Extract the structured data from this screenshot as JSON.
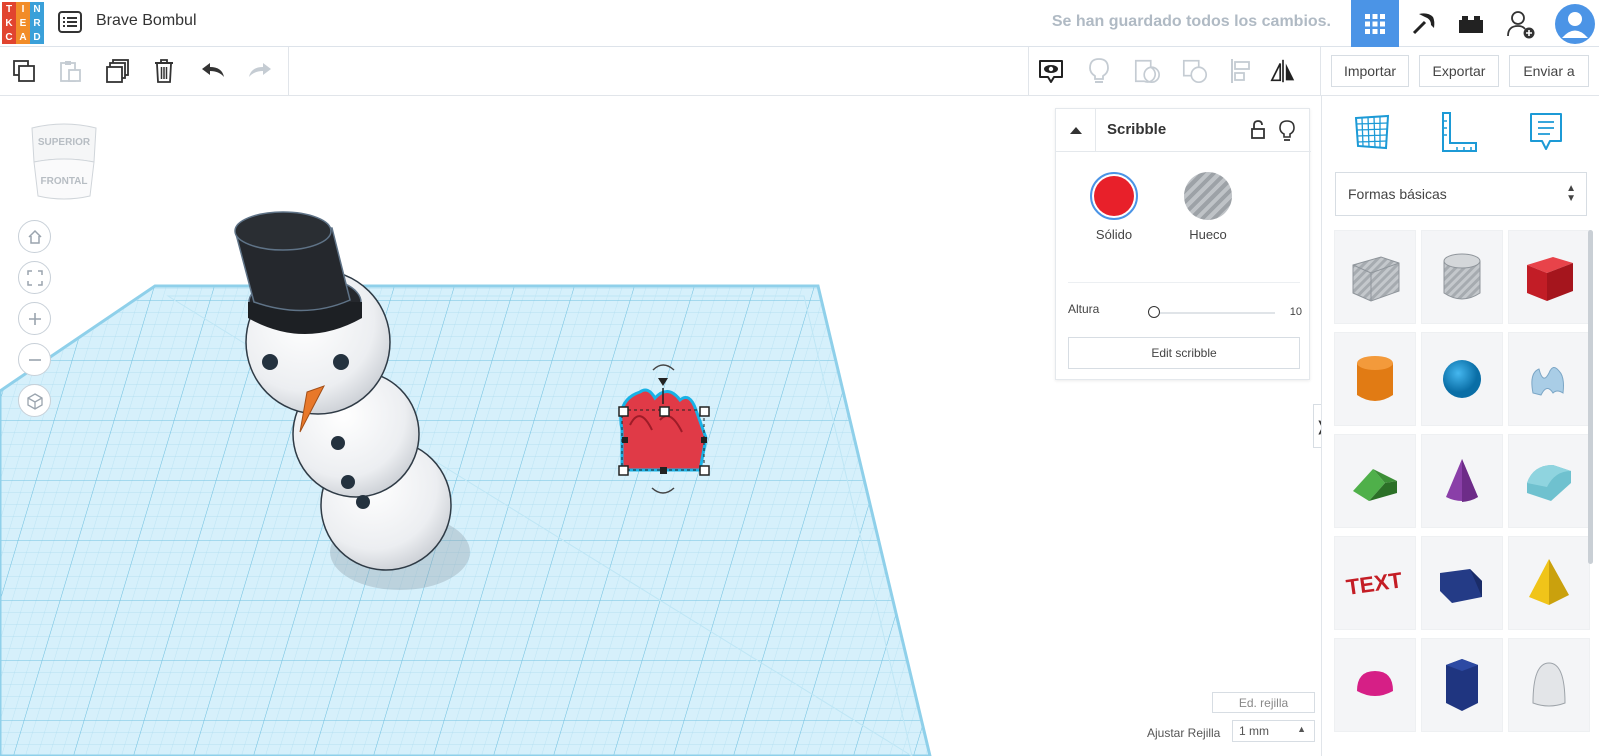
{
  "app": {
    "logo_letters": [
      "T",
      "I",
      "N",
      "K",
      "E",
      "R",
      "C",
      "A",
      "D"
    ],
    "logo_colors": [
      "#e1442f",
      "#f28c28",
      "#3aa0d9",
      "#e1442f",
      "#f28c28",
      "#3aa0d9",
      "#e1442f",
      "#f28c28",
      "#3aa0d9"
    ],
    "design_title": "Brave Bombul",
    "save_status": "Se han guardado todos los cambios.",
    "accent_color": "#4b94e6"
  },
  "header": {
    "buttons": [
      {
        "name": "3d-design-view-icon",
        "active": true
      },
      {
        "name": "minecraft-pickaxe-icon",
        "active": false
      },
      {
        "name": "bricks-icon",
        "active": false
      },
      {
        "name": "invite-user-icon",
        "active": false
      },
      {
        "name": "user-avatar-icon",
        "active": false
      }
    ]
  },
  "toolbar": {
    "left_icons": [
      "copy-icon",
      "paste-icon",
      "duplicate-icon",
      "delete-icon",
      "undo-icon",
      "redo-icon"
    ],
    "right_icons": [
      "show-all-icon",
      "light-bulb-icon",
      "group-icon",
      "ungroup-icon",
      "align-icon",
      "mirror-icon"
    ],
    "import_label": "Importar",
    "export_label": "Exportar",
    "send_label": "Enviar a"
  },
  "viewcube": {
    "top_label": "SUPERIOR",
    "front_label": "FRONTAL"
  },
  "nav_controls": [
    "home-view-icon",
    "fit-view-icon",
    "zoom-in-icon",
    "zoom-out-icon",
    "perspective-icon"
  ],
  "inspector": {
    "title": "Scribble",
    "solid_label": "Sólido",
    "hole_label": "Hueco",
    "solid_color": "#e8202a",
    "height_label": "Altura",
    "height_value": "10",
    "edit_button": "Edit scribble"
  },
  "shapes_panel": {
    "tabs": [
      "workplane-icon",
      "ruler-icon",
      "notes-icon"
    ],
    "category": "Formas básicas",
    "shapes": [
      "box-hole",
      "cylinder-hole",
      "box",
      "cylinder",
      "sphere",
      "scribble",
      "roof",
      "cone",
      "round-roof",
      "text",
      "wedge",
      "pyramid",
      "half-sphere",
      "polygon",
      "paraboloid"
    ]
  },
  "grid_controls": {
    "edit_grid": "Ed. rejilla",
    "snap_label": "Ajustar Rejilla",
    "snap_value": "1 mm"
  }
}
